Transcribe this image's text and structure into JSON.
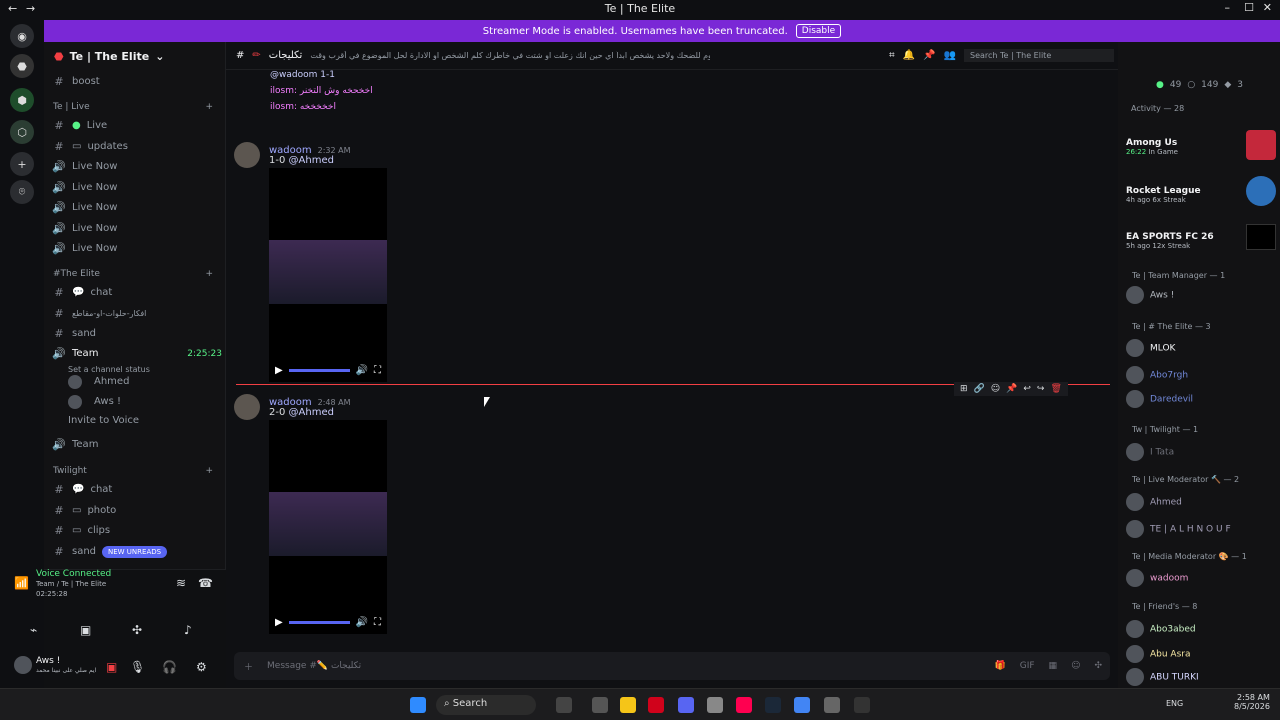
{
  "window": {
    "title": "Te | The Elite"
  },
  "banner": {
    "text": "Streamer Mode is enabled. Usernames have been truncated.",
    "button": "Disable"
  },
  "server": {
    "name": "Te | The Elite"
  },
  "sidebar": {
    "top_channel": "boost",
    "categories": [
      {
        "name": "Te | Live",
        "channels": [
          "Live",
          "updates",
          "Live Now",
          "Live Now",
          "Live Now",
          "Live Now",
          "Live Now"
        ]
      },
      {
        "name": "#The Elite",
        "channels": [
          "chat",
          "افكار-حلوات-او-مقاطع",
          "sand"
        ]
      },
      {
        "name": "Twilight",
        "channels": [
          "chat",
          "photo",
          "clips",
          "sand"
        ]
      }
    ],
    "team": {
      "name": "Team",
      "time": "2:25:23",
      "status": "Set a channel status",
      "members": [
        "Ahmed",
        "Aws !"
      ],
      "invite": "Invite to Voice"
    },
    "team2": "Team",
    "new_unreads": "NEW UNREADS"
  },
  "voice": {
    "state": "Voice Connected",
    "channel": "Team / Te | The Elite",
    "time": "02:25:28"
  },
  "user": {
    "name": "Aws !",
    "status": "ايم صلي على نبينا محمد"
  },
  "channel": {
    "name": "تكليجات",
    "topic": "روم للضحك ولاحد يشخص ابداً اي حين انك زعلت او شتت في خاطرك كلم الشخص او الادارة لحل الموضوع في أقرب وقت",
    "search": "Search Te | The Elite"
  },
  "reply_block": {
    "title": "@wadoom 1-1",
    "lines": [
      "ilosm: اخخحخه وش التخنر",
      "ilosm: اخخخخخه"
    ]
  },
  "messages": [
    {
      "author": "wadoom",
      "time": "2:32 AM",
      "text": "1-0",
      "mention": "@Ahmed"
    },
    {
      "author": "wadoom",
      "time": "2:48 AM",
      "text": "2-0",
      "mention": "@Ahmed"
    }
  ],
  "composer": {
    "placeholder": "Message #✏️ تكليجات"
  },
  "members": {
    "online_count": "49",
    "offline_count": "149",
    "boost": "3",
    "activity_header": "Activity — 28",
    "activities": [
      {
        "game": "Among Us",
        "meta": "26:22",
        "status": "In Game"
      },
      {
        "game": "Rocket League",
        "meta": "4h ago",
        "status": "6x Streak"
      },
      {
        "game": "EA SPORTS FC 26",
        "meta": "5h ago",
        "status": "12x Streak"
      }
    ],
    "groups": [
      {
        "name": "Te | Team Manager — 1",
        "members": [
          "Aws !"
        ]
      },
      {
        "name": "Te | # The Elite — 3",
        "members": [
          "MLOK",
          "Abo7rgh",
          "Daredevil"
        ]
      },
      {
        "name": "Tw | Twilight — 1",
        "members": [
          "I Tata"
        ]
      },
      {
        "name": "Te | Live Moderator 🔨 — 2",
        "members": [
          "Ahmed",
          "TE | A L H N O U F"
        ]
      },
      {
        "name": "Te | Media Moderator 🎨 — 1",
        "members": [
          "wadoom"
        ]
      },
      {
        "name": "Te | Friend's — 8",
        "members": [
          "Abo3abed",
          "Abu Asra",
          "ABU TURKI"
        ]
      }
    ]
  },
  "taskbar": {
    "search": "Search",
    "lang": "ENG",
    "time": "2:58 AM",
    "date": "8/5/2026"
  }
}
